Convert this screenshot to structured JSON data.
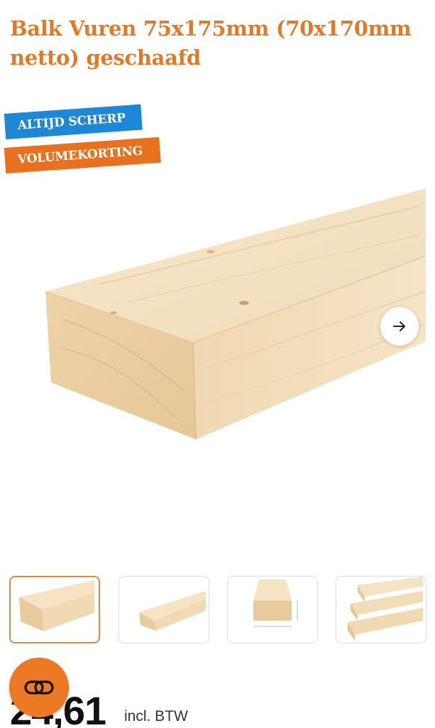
{
  "product": {
    "title": "Balk Vuren 75x175mm (70x170mm netto) geschaafd"
  },
  "badges": {
    "sharp": "ALTIJD SCHERP",
    "volume": "VOLUMEKORTING"
  },
  "gallery": {
    "next_icon": "arrow-right-icon",
    "thumbnail_count": 4,
    "active_thumbnail": 1
  },
  "price": {
    "amount": "24,61",
    "vat_label": "incl. BTW"
  },
  "fab": {
    "icon": "compare-link-icon"
  },
  "colors": {
    "accent_orange": "#e07a26",
    "badge_blue": "#1e88d6",
    "badge_orange": "#e8711f",
    "wood_light": "#f3dfc0",
    "wood_mid": "#e9cfa6"
  }
}
